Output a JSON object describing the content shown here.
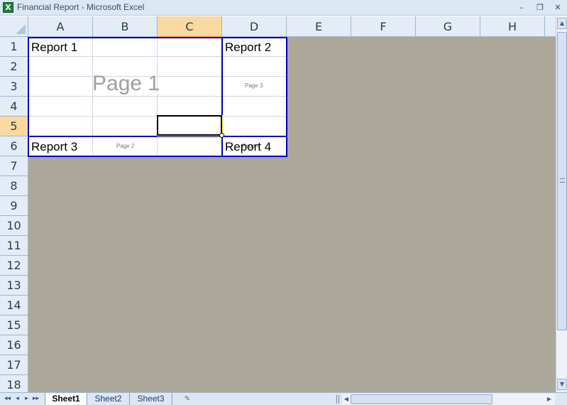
{
  "window": {
    "title": "Financial Report - Microsoft Excel",
    "app_icon_glyph": "X",
    "minimize_glyph": "–",
    "restore_glyph": "❐",
    "close_glyph": "✕"
  },
  "columns": [
    "A",
    "B",
    "C",
    "D",
    "E",
    "F",
    "G",
    "H"
  ],
  "rows": [
    "1",
    "2",
    "3",
    "4",
    "5",
    "6",
    "7",
    "8",
    "9",
    "10",
    "11",
    "12",
    "13",
    "14",
    "15",
    "16",
    "17",
    "18"
  ],
  "selected_cell": "C5",
  "cells": {
    "A1": "Report 1",
    "D1": "Report 2",
    "A6": "Report 3",
    "D6": "Report 4"
  },
  "page_watermarks": {
    "page1": "Page 1",
    "page2": "Page 2",
    "page3": "Page 3",
    "page4": "Page 4"
  },
  "sheet_tabs": [
    "Sheet1",
    "Sheet2",
    "Sheet3"
  ],
  "active_sheet": "Sheet1",
  "nav": {
    "first": "◂◂",
    "prev": "◂",
    "next": "▸",
    "last": "▸▸"
  },
  "colors": {
    "page_break": "#0000c0",
    "header_selected": "#f9d99f",
    "outside_print_area": "#aca899"
  },
  "icons": {
    "app": "excel-icon",
    "insert_sheet": "insert-worksheet-icon"
  }
}
